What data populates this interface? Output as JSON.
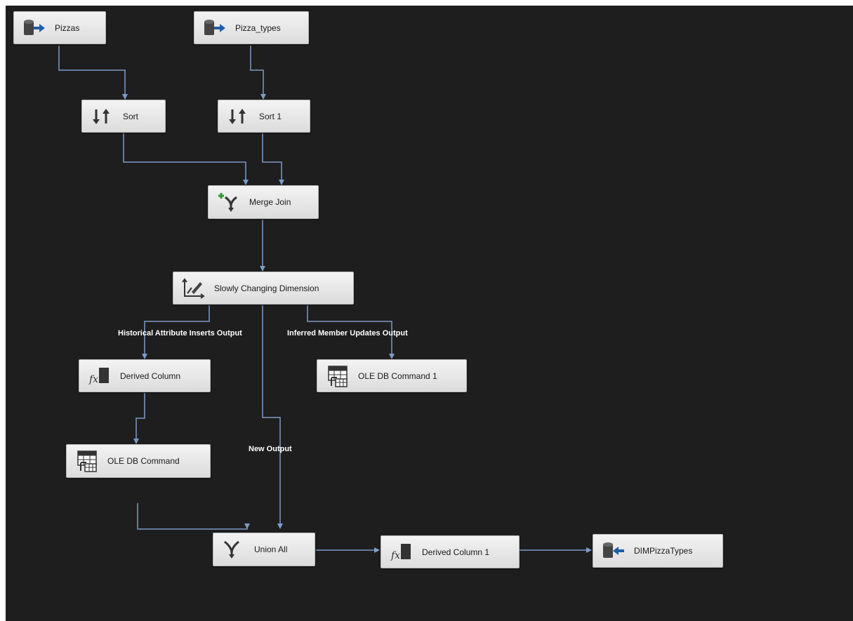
{
  "nodes": {
    "pizzas": {
      "label": "Pizzas",
      "icon": "source-database-icon"
    },
    "pizza_types": {
      "label": "Pizza_types",
      "icon": "source-database-icon"
    },
    "sort": {
      "label": "Sort",
      "icon": "sort-icon"
    },
    "sort1": {
      "label": "Sort 1",
      "icon": "sort-icon"
    },
    "merge_join": {
      "label": "Merge Join",
      "icon": "merge-join-icon"
    },
    "scd": {
      "label": "Slowly Changing Dimension",
      "icon": "slowly-changing-dimension-icon"
    },
    "derived_column": {
      "label": "Derived Column",
      "icon": "derived-column-icon"
    },
    "ole_db_command_1": {
      "label": "OLE DB Command 1",
      "icon": "ole-db-command-icon"
    },
    "ole_db_command": {
      "label": "OLE DB Command",
      "icon": "ole-db-command-icon"
    },
    "union_all": {
      "label": "Union All",
      "icon": "union-all-icon"
    },
    "derived_column_1": {
      "label": "Derived Column 1",
      "icon": "derived-column-icon"
    },
    "dim_pizza_types": {
      "label": "DIMPizzaTypes",
      "icon": "destination-database-icon"
    }
  },
  "paths": {
    "historical": "Historical Attribute Inserts Output",
    "inferred": "Inferred Member Updates Output",
    "new_output": "New Output"
  },
  "colors": {
    "canvas": "#1e1e1e",
    "wire": "#7b9cc7",
    "db_blue": "#1f5ea8",
    "add_green": "#2f9a2f"
  }
}
